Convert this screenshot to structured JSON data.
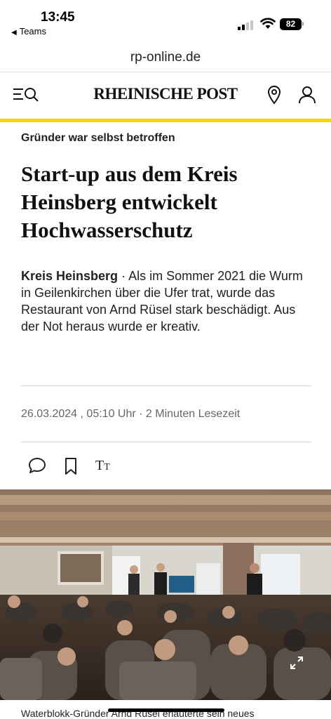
{
  "status": {
    "time": "13:45",
    "back_app": "Teams",
    "battery": "82"
  },
  "browser": {
    "url": "rp-online.de"
  },
  "header": {
    "logo": "RHEINISCHE POST"
  },
  "article": {
    "kicker": "Gründer war selbst betroffen",
    "headline": "Start-up aus dem Kreis Heinsberg entwickelt Hochwasserschutz",
    "teaser_place": "Kreis Heinsberg",
    "teaser_sep": " · ",
    "teaser_text": "Als im Sommer 2021 die Wurm in Geilenkirchen über die Ufer trat, wurde das Restaurant von Arnd Rüsel stark beschädigt. Aus der Not heraus wurde er kreativ.",
    "date": "26.03.2024",
    "time": ", 05:10 Uhr",
    "meta_sep": " · ",
    "read_time": "2 Minuten Lesezeit",
    "font_size_label": "T",
    "font_size_label_small": "T",
    "caption": "Waterblokk-Gründer Arnd Rüsel erläuterte sein neues"
  },
  "colors": {
    "accent_yellow": "#f6d400"
  },
  "icons": [
    "menu-search-icon",
    "location-pin-icon",
    "user-icon",
    "comment-icon",
    "bookmark-icon",
    "font-size-icon",
    "expand-icon"
  ]
}
